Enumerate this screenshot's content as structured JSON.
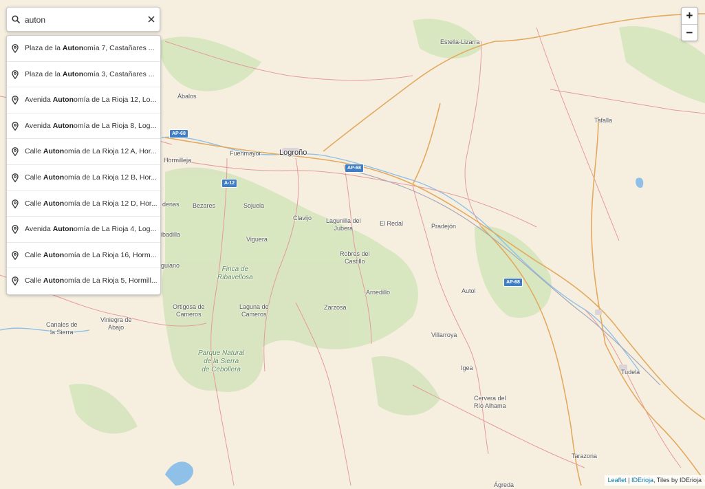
{
  "search": {
    "query": "auton",
    "placeholder": "",
    "results": [
      {
        "pre": "Plaza de la ",
        "match": "Auton",
        "post": "omía 7, Castañares ..."
      },
      {
        "pre": "Plaza de la ",
        "match": "Auton",
        "post": "omía 3, Castañares ..."
      },
      {
        "pre": "Avenida ",
        "match": "Auton",
        "post": "omía de La Rioja 12, Lo..."
      },
      {
        "pre": "Avenida ",
        "match": "Auton",
        "post": "omía de La Rioja 8, Log..."
      },
      {
        "pre": "Calle ",
        "match": "Auton",
        "post": "omía de La Rioja 12 A, Hor..."
      },
      {
        "pre": "Calle ",
        "match": "Auton",
        "post": "omía de La Rioja 12 B, Hor..."
      },
      {
        "pre": "Calle ",
        "match": "Auton",
        "post": "omía de La Rioja 12 D, Hor..."
      },
      {
        "pre": "Avenida ",
        "match": "Auton",
        "post": "omía de La Rioja 4, Log..."
      },
      {
        "pre": "Calle ",
        "match": "Auton",
        "post": "omía de La Rioja 16, Horm..."
      },
      {
        "pre": "Calle ",
        "match": "Auton",
        "post": "omía de La Rioja 5, Hormill..."
      }
    ]
  },
  "zoom": {
    "in_label": "+",
    "out_label": "−"
  },
  "attribution": {
    "leaflet": "Leaflet",
    "sep": " | ",
    "iderioja": "IDErioja",
    "tiles": ", Tiles by IDErioja"
  },
  "places": {
    "estella": "Estella-Lizarra",
    "abalos": "Ábalos",
    "tafalla": "Tafalla",
    "fuenmayor": "Fuenmayor",
    "logrono": "Logroño",
    "hormilleja": "Hormilleja",
    "bezares": "Bezares",
    "sojuela": "Sojuela",
    "clavijo": "Clavijo",
    "lagunilla": "Lagunilla del\nJubera",
    "elredal": "El Redal",
    "pradejon": "Pradejón",
    "viguera": "Viguera",
    "robres": "Robres del\nCastillo",
    "finca": "Finca de\nRibavellosa",
    "arnedillo": "Arnedillo",
    "autol": "Autol",
    "ortigosa": "Ortigosa de\nCameros",
    "laguna": "Laguna de\nCameros",
    "zarzosa": "Zarzosa",
    "canales": "Canales de\nla Sierra",
    "viniegra": "Viniegra de\nAbajo",
    "villarroya": "Villarroya",
    "parque": "Parque Natural\nde la Sierra\nde Cebollera",
    "igea": "Igea",
    "tudela": "Tudela",
    "cervera": "Cervera del\nRío Alhama",
    "tarazona": "Tarazona",
    "agreda": "Ágreda",
    "denas": "denas",
    "ibadilla": "ibadilla",
    "guiano": "guiano"
  },
  "shields": {
    "ap68_1": "AP-68",
    "ap68_2": "AP-68",
    "ap68_3": "AP-68",
    "a12": "A-12"
  },
  "colors": {
    "land": "#f6efe0",
    "forest": "#cfe2b7",
    "water": "#7fb6e3",
    "road_main": "#e0a85a",
    "road_secondary": "#e28d8d",
    "accent": "#3f7ec5"
  }
}
